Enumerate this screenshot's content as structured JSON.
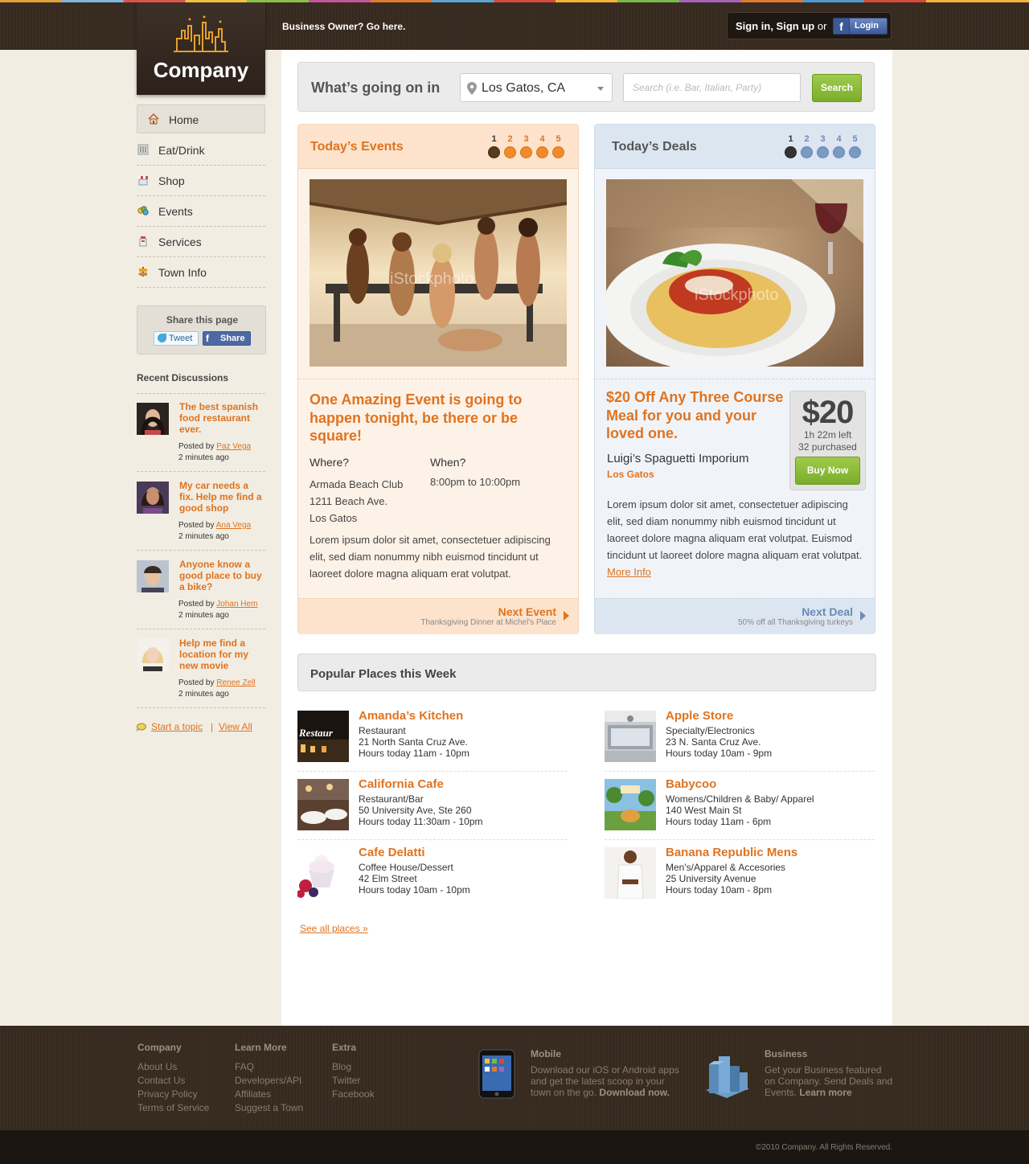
{
  "header": {
    "logo_text": "Company",
    "business_owner_label": "Business Owner?",
    "business_owner_link": "Go here.",
    "signin_label": "Sign in, Sign up",
    "or_label": "or",
    "fb_login_label": "Login"
  },
  "nav": {
    "items": [
      {
        "label": "Home",
        "icon": "home-icon"
      },
      {
        "label": "Eat/Drink",
        "icon": "fork-knife-icon"
      },
      {
        "label": "Shop",
        "icon": "shop-icon"
      },
      {
        "label": "Events",
        "icon": "events-icon"
      },
      {
        "label": "Services",
        "icon": "services-icon"
      },
      {
        "label": "Town Info",
        "icon": "signpost-icon"
      }
    ]
  },
  "share": {
    "title": "Share this page",
    "tweet_label": "Tweet",
    "share_label": "Share"
  },
  "recent": {
    "title": "Recent Discussions",
    "posted_by_label": "Posted by",
    "items": [
      {
        "title": "The best spanish food restaurant ever.",
        "author": "Paz Vega",
        "ago": "2 minutes ago"
      },
      {
        "title": "My car needs a fix. Help me find a good shop",
        "author": "Ana Vega",
        "ago": "2 minutes ago"
      },
      {
        "title": "Anyone know a good place to buy a bike?",
        "author": "Johan Hem",
        "ago": "2 minutes ago"
      },
      {
        "title": "Help me find a location for my new movie",
        "author": "Renee Zell",
        "ago": "2 minutes ago"
      }
    ],
    "start_topic": "Start a topic",
    "separator": "|",
    "view_all": "View All"
  },
  "search": {
    "question": "What’s going on in",
    "location": "Los Gatos, CA",
    "placeholder": "Search (i.e. Bar, Italian, Party)",
    "button": "Search"
  },
  "events": {
    "title": "Today’s Events",
    "pages": [
      "1",
      "2",
      "3",
      "4",
      "5"
    ],
    "current_page": 1,
    "headline": "One Amazing Event is going to happen tonight, be there or be square!",
    "where_label": "Where?",
    "when_label": "When?",
    "where_lines": [
      "Armada Beach Club",
      "1211 Beach Ave.",
      "Los Gatos"
    ],
    "when": "8:00pm to 10:00pm",
    "description": "Lorem ipsum dolor sit amet, consectetuer adipiscing elit, sed diam nonummy nibh euismod tincidunt ut laoreet dolore magna aliquam erat volutpat.",
    "next_label": "Next Event",
    "next_sub": "Thanksgiving Dinner at Michel's Place",
    "watermark": "iStockphoto"
  },
  "deals": {
    "title": "Today’s Deals",
    "pages": [
      "1",
      "2",
      "3",
      "4",
      "5"
    ],
    "current_page": 1,
    "headline": "$20 Off Any Three Course Meal for you and your loved one.",
    "vendor": "Luigi’s Spaguetti Imporium",
    "town": "Los Gatos",
    "price": "$20",
    "time_left": "1h 22m left",
    "purchased": "32 purchased",
    "buy_label": "Buy Now",
    "description": "Lorem ipsum dolor sit amet, consectetuer adipiscing elit, sed diam nonummy nibh euismod tincidunt ut laoreet dolore magna aliquam erat volutpat. Euismod tincidunt ut laoreet dolore magna aliquam erat volutpat.",
    "more_info": "More Info",
    "next_label": "Next Deal",
    "next_sub": "50% off all Thanksgiving turkeys",
    "watermark": "iStockphoto"
  },
  "popular": {
    "title": "Popular Places this Week",
    "places": [
      {
        "name": "Amanda’s Kitchen",
        "category": "Restaurant",
        "address": "21 North Santa Cruz Ave.",
        "hours": "Hours today 11am - 10pm"
      },
      {
        "name": "Apple Store",
        "category": "Specialty/Electronics",
        "address": "23 N. Santa Cruz Ave.",
        "hours": "Hours today 10am - 9pm"
      },
      {
        "name": "California Cafe",
        "category": "Restaurant/Bar",
        "address": "50 University Ave, Ste 260",
        "hours": "Hours today 11:30am - 10pm"
      },
      {
        "name": "Babycoo",
        "category": "Womens/Children & Baby/ Apparel",
        "address": "140 West Main St",
        "hours": "Hours today 11am - 6pm"
      },
      {
        "name": "Cafe Delatti",
        "category": "Coffee House/Dessert",
        "address": "42 Elm Street",
        "hours": "Hours today 10am - 10pm"
      },
      {
        "name": "Banana Republic Mens",
        "category": "Men's/Apparel & Accesories",
        "address": "25 University Avenue",
        "hours": "Hours today 10am - 8pm"
      }
    ],
    "see_all": "See all places »",
    "thumb_text": "Restaur"
  },
  "footer": {
    "columns": [
      {
        "title": "Company",
        "links": [
          "About Us",
          "Contact Us",
          "Privacy Policy",
          "Terms of Service"
        ]
      },
      {
        "title": "Learn More",
        "links": [
          "FAQ",
          "Developers/API",
          "Affiliates",
          "Suggest a Town"
        ]
      },
      {
        "title": "Extra",
        "links": [
          "Blog",
          "Twitter",
          "Facebook"
        ]
      }
    ],
    "mobile_title": "Mobile",
    "mobile_text": "Download our iOS or Android apps and get the latest scoop in your town on the go.",
    "mobile_link": "Download now.",
    "business_title": "Business",
    "business_text": "Get your Business featured on Company. Send Deals and Events.",
    "business_link": "Learn more",
    "copyright": "©2010 Company. All Rights Reserved."
  },
  "colors": {
    "accent_orange": "#e0731f",
    "green_button": "#8dbd3a",
    "header_brown": "#3a2d22",
    "deal_blue": "#6a8bb5"
  }
}
